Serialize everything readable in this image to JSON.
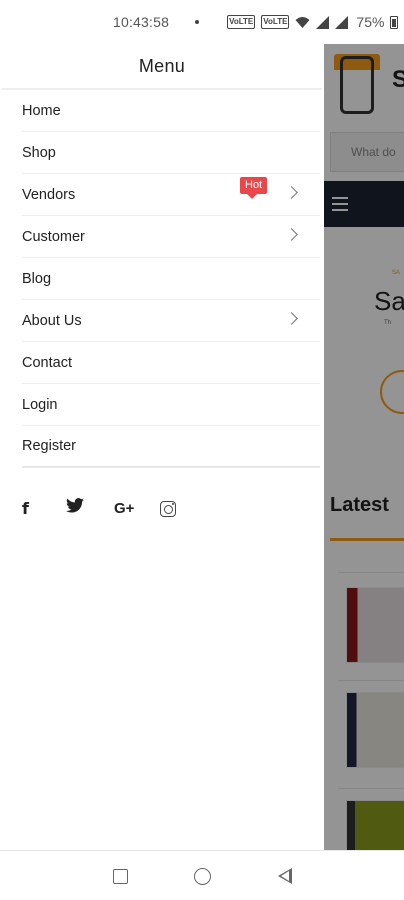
{
  "status_bar": {
    "time": "10:43:58",
    "battery": "75%",
    "icons": [
      "volte-icon",
      "volte2-icon",
      "wifi-icon",
      "signal-icon",
      "signal-icon",
      "battery-icon"
    ]
  },
  "background": {
    "brand_initial": "S",
    "search_placeholder": "What do",
    "big_text": "Sa",
    "latest_heading": "Latest"
  },
  "drawer": {
    "title": "Menu",
    "items": [
      {
        "label": "Home",
        "has_chevron": false
      },
      {
        "label": "Shop",
        "has_chevron": false
      },
      {
        "label": "Vendors",
        "has_chevron": true,
        "badge": "Hot"
      },
      {
        "label": "Customer",
        "has_chevron": true
      },
      {
        "label": "Blog",
        "has_chevron": false
      },
      {
        "label": "About Us",
        "has_chevron": true
      },
      {
        "label": "Contact",
        "has_chevron": false
      },
      {
        "label": "Login",
        "has_chevron": false
      },
      {
        "label": "Register",
        "has_chevron": false
      }
    ],
    "social": {
      "facebook": "f",
      "twitter": "twitter-icon",
      "google_plus": "G+",
      "instagram": "instagram-icon"
    }
  },
  "colors": {
    "accent": "#f59c1a",
    "badge": "#e9474a",
    "nav_dark": "#1c2431"
  }
}
